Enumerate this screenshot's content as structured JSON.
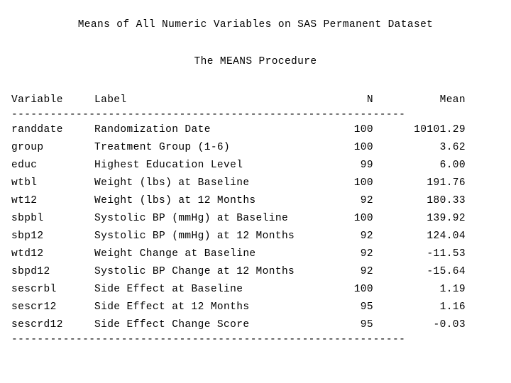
{
  "report": {
    "title": "Means of All Numeric Variables on SAS Permanent Dataset",
    "subtitle": "The MEANS Procedure",
    "top_rule": "-------------------------------------------------------------",
    "bottom_rule": "-------------------------------------------------------------",
    "columns": {
      "variable": "Variable",
      "label": "Label",
      "n": "N",
      "mean": "Mean"
    },
    "rows": [
      {
        "variable": "randdate",
        "label": "Randomization Date",
        "n": "100",
        "mean": "10101.29"
      },
      {
        "variable": "group",
        "label": "Treatment Group (1-6)",
        "n": "100",
        "mean": "3.62"
      },
      {
        "variable": "educ",
        "label": "Highest Education Level",
        "n": "99",
        "mean": "6.00"
      },
      {
        "variable": "wtbl",
        "label": "Weight (lbs) at Baseline",
        "n": "100",
        "mean": "191.76"
      },
      {
        "variable": "wt12",
        "label": "Weight (lbs) at 12 Months",
        "n": "92",
        "mean": "180.33"
      },
      {
        "variable": "sbpbl",
        "label": "Systolic BP (mmHg) at Baseline",
        "n": "100",
        "mean": "139.92"
      },
      {
        "variable": "sbp12",
        "label": "Systolic BP (mmHg) at 12 Months",
        "n": "92",
        "mean": "124.04"
      },
      {
        "variable": "wtd12",
        "label": "Weight Change at Baseline",
        "n": "92",
        "mean": "-11.53"
      },
      {
        "variable": "sbpd12",
        "label": "Systolic BP Change at 12 Months",
        "n": "92",
        "mean": "-15.64"
      },
      {
        "variable": "sescrbl",
        "label": "Side Effect at Baseline",
        "n": "100",
        "mean": "1.19"
      },
      {
        "variable": "sescr12",
        "label": "Side Effect at 12 Months",
        "n": "95",
        "mean": "1.16"
      },
      {
        "variable": "sescrd12",
        "label": "Side Effect Change Score",
        "n": "95",
        "mean": "-0.03"
      }
    ]
  }
}
